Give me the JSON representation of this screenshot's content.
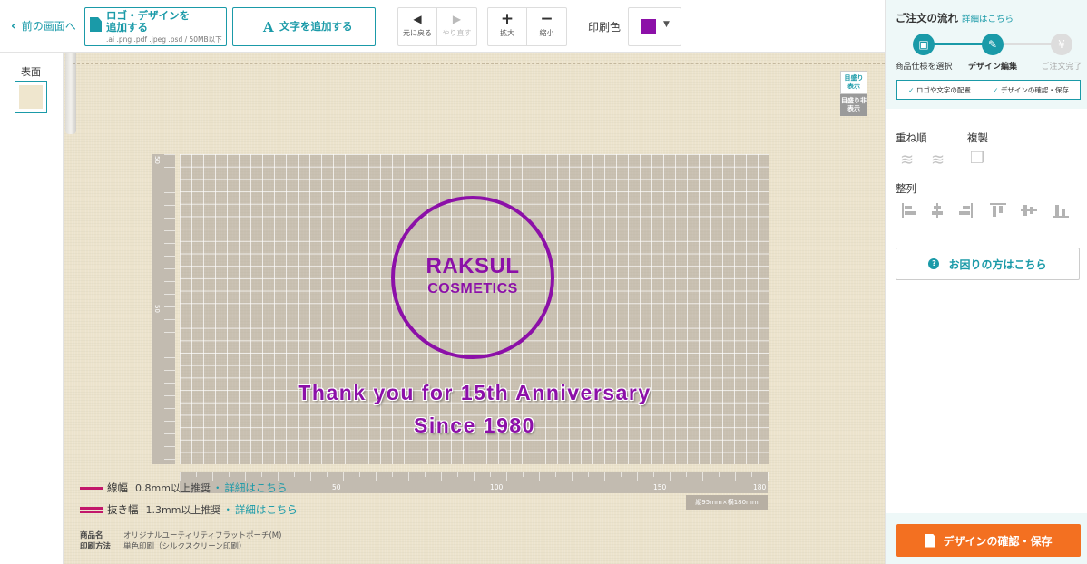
{
  "toolbar": {
    "back_label": "前の画面へ",
    "upload_label_line1": "ロゴ・デザインを",
    "upload_label_line2": "追加する",
    "upload_formats": ".ai .png .pdf .jpeg .psd / 50MB以下",
    "add_text_label": "文字を追加する",
    "undo_label": "元に戻る",
    "redo_label": "やり直す",
    "zoom_in_label": "拡大",
    "zoom_out_label": "縮小",
    "print_color_label": "印刷色",
    "print_color": "#8c10a8"
  },
  "left_panel": {
    "page_label": "表面"
  },
  "canvas": {
    "grid_show_label": "目盛り表示",
    "grid_hide_label": "目盛り非表示",
    "ruler_left_labels": [
      "50",
      "50"
    ],
    "ruler_bottom_labels": [
      "50",
      "100",
      "150",
      "180"
    ],
    "size_label": "縦95mm×横180mm",
    "logo_line1": "RAKSUL",
    "logo_line2": "COSMETICS",
    "anniversary_line1": "Thank you for 15th Anniversary",
    "anniversary_line2": "Since 1980",
    "legend": [
      {
        "name": "線幅",
        "value": "0.8mm以上推奨",
        "sep": "・",
        "link": "詳細はこちら"
      },
      {
        "name": "抜き幅",
        "value": "1.3mm以上推奨",
        "sep": "・",
        "link": "詳細はこちら"
      }
    ],
    "product_key": "商品名",
    "product_value": "オリジナルユーティリティフラットポーチ(M)",
    "method_key": "印刷方法",
    "method_value": "単色印刷（シルクスクリーン印刷）"
  },
  "sidebar": {
    "flow_title": "ご注文の流れ",
    "flow_link": "詳細はこちら",
    "steps": [
      {
        "label": "商品仕様を選択",
        "state": "done"
      },
      {
        "label": "デザイン編集",
        "state": "current"
      },
      {
        "label": "ご注文完了",
        "state": "todo"
      }
    ],
    "substeps": [
      "ロゴや文字の配置",
      "デザインの確認・保存"
    ],
    "layer_label": "重ね順",
    "duplicate_label": "複製",
    "align_label": "整列",
    "help_label": "お困りの方はこちら",
    "save_label": "デザインの確認・保存",
    "accent_color": "#1a9aa8",
    "save_color": "#f37021"
  }
}
